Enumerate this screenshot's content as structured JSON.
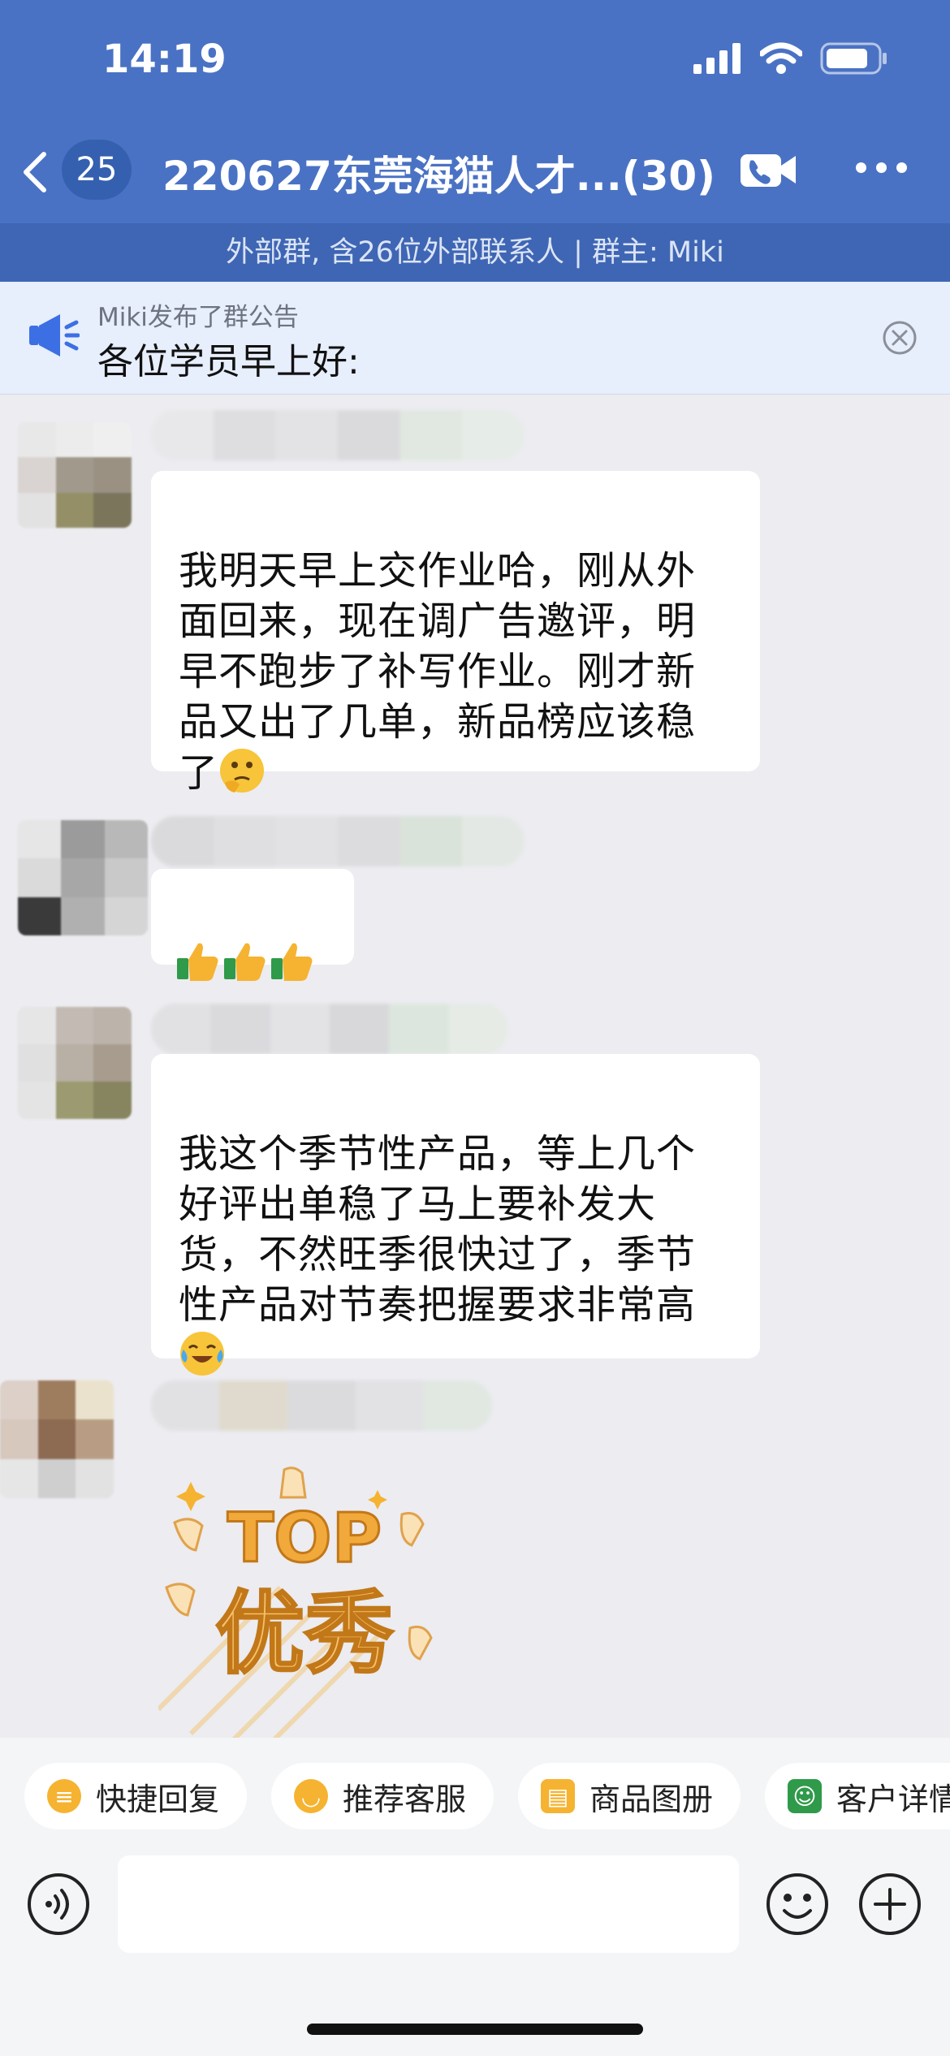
{
  "status_bar": {
    "time": "14:19",
    "icons": [
      "cellular-signal-icon",
      "wifi-icon",
      "battery-icon"
    ]
  },
  "header": {
    "back_icon": "chevron-left-icon",
    "unread_count": "25",
    "title": "220627东莞海猫人才...(30)",
    "video_call_icon": "video-call-icon",
    "more_icon": "more-dots-icon",
    "subtitle": "外部群, 含26位外部联系人 | 群主: Miki"
  },
  "announcement": {
    "icon": "megaphone-icon",
    "publisher": "Miki发布了群公告",
    "text": "各位学员早上好:",
    "close_icon": "close-icon"
  },
  "messages": [
    {
      "text": "我明天早上交作业哈，刚从外\n面回来，现在调广告邀评，明\n早不跑步了补写作业。刚才新\n品又出了几单，新品榜应该稳\n了",
      "emoji": "thinking-emoji"
    },
    {
      "text": "",
      "emoji": "thumbs-up-emoji"
    },
    {
      "text": "我这个季节性产品，等上几个\n好评出单稳了马上要补发大\n货，不然旺季很快过了，季节\n性产品对节奏把握要求非常高",
      "emoji": "crying-laughing-emoji"
    },
    {
      "sticker_text_1": "TOP",
      "sticker_text_2": "优秀"
    }
  ],
  "quick_actions": [
    {
      "label": "快捷回复",
      "icon": "quick-reply-icon"
    },
    {
      "label": "推荐客服",
      "icon": "recommend-service-icon"
    },
    {
      "label": "商品图册",
      "icon": "product-catalog-icon"
    },
    {
      "label": "客户详情",
      "icon": "customer-detail-icon"
    }
  ],
  "input_bar": {
    "voice_icon": "voice-icon",
    "emoji_icon": "emoji-icon",
    "plus_icon": "plus-icon"
  },
  "colors": {
    "header_bg": "#4a72c4",
    "subbar_bg": "#3f66b4",
    "notice_bg": "#e7eefc",
    "chat_bg": "#ececf1",
    "chip_icon": "#f5b331"
  }
}
